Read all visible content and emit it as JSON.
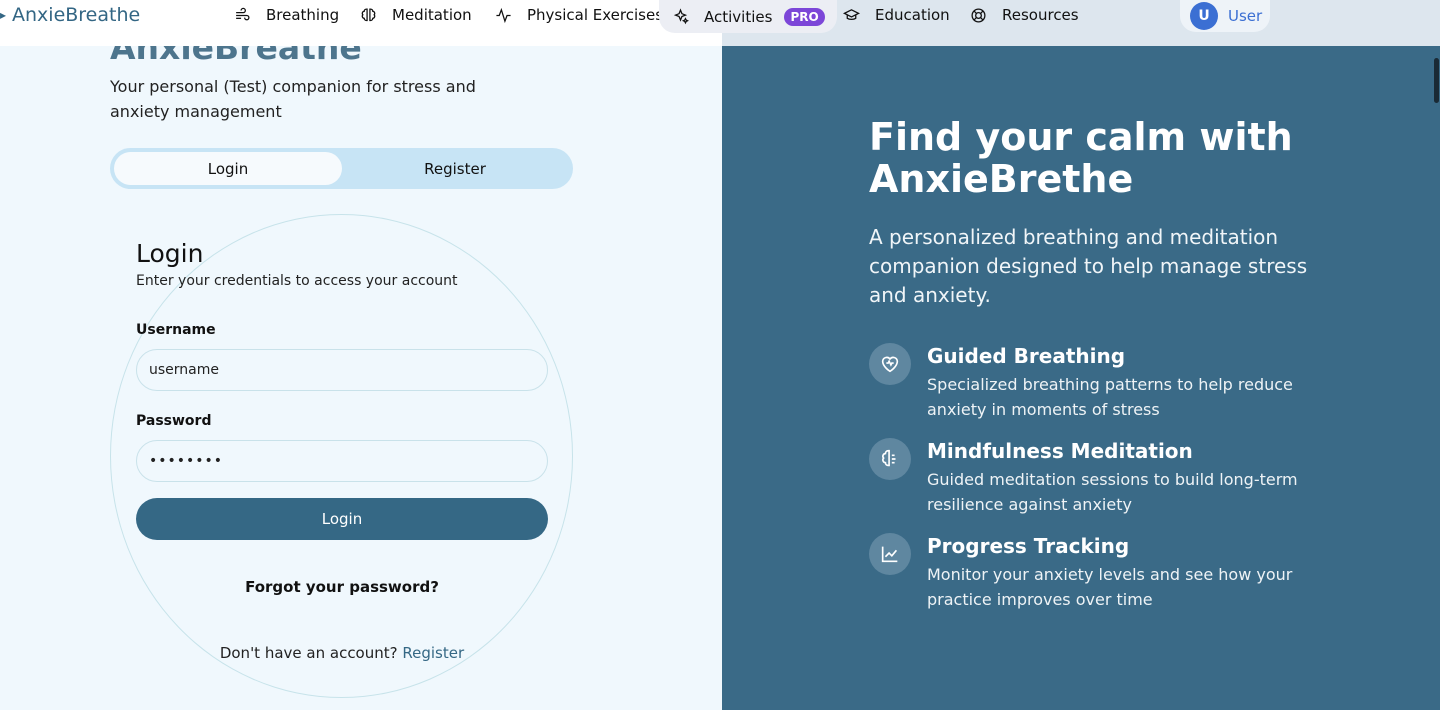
{
  "nav": {
    "brand": "AnxieBreathe",
    "items": [
      {
        "label": "Breathing",
        "icon": "wind-icon"
      },
      {
        "label": "Meditation",
        "icon": "brain-icon"
      },
      {
        "label": "Physical Exercises",
        "icon": "activity-icon"
      },
      {
        "label": "Activities",
        "icon": "sparkles-icon",
        "badge": "PRO"
      },
      {
        "label": "Education",
        "icon": "graduation-cap-icon"
      },
      {
        "label": "Resources",
        "icon": "lifebuoy-icon"
      }
    ],
    "user": {
      "initial": "U",
      "label": "User"
    }
  },
  "left": {
    "heading": "AnxieBreathe",
    "tagline": "Your personal (Test) companion for stress and anxiety management",
    "tabs": {
      "login": "Login",
      "register": "Register"
    },
    "form": {
      "title": "Login",
      "subtitle": "Enter your credentials to access your account",
      "username_label": "Username",
      "username_value": "username",
      "password_label": "Password",
      "password_value": "••••••••",
      "submit": "Login",
      "forgot": "Forgot your password?",
      "no_account": "Don't have an account?",
      "register_link": "Register"
    }
  },
  "right": {
    "title": "Find your calm with AnxieBrethe",
    "subtitle": "A personalized breathing and meditation companion designed to help manage stress and anxiety.",
    "features": [
      {
        "title": "Guided Breathing",
        "desc": "Specialized breathing patterns to help reduce anxiety in moments of stress",
        "icon": "heart-icon"
      },
      {
        "title": "Mindfulness Meditation",
        "desc": "Guided meditation sessions to build long-term resilience against anxiety",
        "icon": "brain-icon"
      },
      {
        "title": "Progress Tracking",
        "desc": "Monitor your anxiety levels and see how your practice improves over time",
        "icon": "line-chart-icon"
      }
    ]
  },
  "colors": {
    "accent": "#356885",
    "panel": "#3a6a87",
    "pro_badge": "#7c46d8",
    "avatar": "#3b6fd3"
  }
}
